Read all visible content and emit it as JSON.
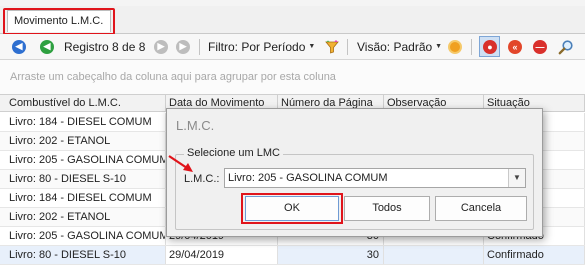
{
  "tab": {
    "label": "Movimento L.M.C."
  },
  "toolbar": {
    "record_label": "Registro 8 de 8",
    "filter_label": "Filtro: Por Período",
    "view_label": "Visão: Padrão"
  },
  "group_hint": "Arraste um cabeçalho da coluna aqui para agrupar por esta coluna",
  "grid": {
    "columns": [
      "Combustível do L.M.C.",
      "Data do Movimento",
      "Número da Página",
      "Observação",
      "Situação"
    ],
    "rows": [
      {
        "fuel": "Livro: 184 - DIESEL COMUM",
        "date": "",
        "page": "",
        "obs": "",
        "status": ""
      },
      {
        "fuel": "Livro: 202 - ETANOL",
        "date": "",
        "page": "",
        "obs": "",
        "status": ""
      },
      {
        "fuel": "Livro: 205 - GASOLINA COMUM",
        "date": "",
        "page": "",
        "obs": "",
        "status": ""
      },
      {
        "fuel": "Livro: 80 - DIESEL S-10",
        "date": "",
        "page": "",
        "obs": "",
        "status": ""
      },
      {
        "fuel": "Livro: 184 - DIESEL COMUM",
        "date": "",
        "page": "",
        "obs": "",
        "status": ""
      },
      {
        "fuel": "Livro: 202 - ETANOL",
        "date": "",
        "page": "",
        "obs": "",
        "status": ""
      },
      {
        "fuel": "Livro: 205 - GASOLINA COMUM",
        "date": "29/04/2019",
        "page": "30",
        "obs": "",
        "status": "Confirmado"
      },
      {
        "fuel": "Livro: 80 - DIESEL S-10",
        "date": "29/04/2019",
        "page": "30",
        "obs": "",
        "status": "Confirmado"
      }
    ]
  },
  "dialog": {
    "title": "L.M.C.",
    "group_label": "Selecione um LMC",
    "field_label": "L.M.C.:",
    "selected_value": "Livro: 205 - GASOLINA COMUM",
    "ok_label": "OK",
    "all_label": "Todos",
    "cancel_label": "Cancela"
  },
  "colors": {
    "highlight": "#e0141b",
    "nav_blue": "#2e6fd0",
    "nav_green": "#2ea040",
    "action_red": "#d9302c",
    "action_orange": "#f0a020"
  },
  "icons": [
    "first-record-icon",
    "next-record-icon",
    "prev-disabled-icon",
    "last-disabled-icon",
    "filter-funnel-icon",
    "view-settings-icon",
    "record-icon",
    "rewind-icon",
    "cancel-icon",
    "search-icon"
  ]
}
